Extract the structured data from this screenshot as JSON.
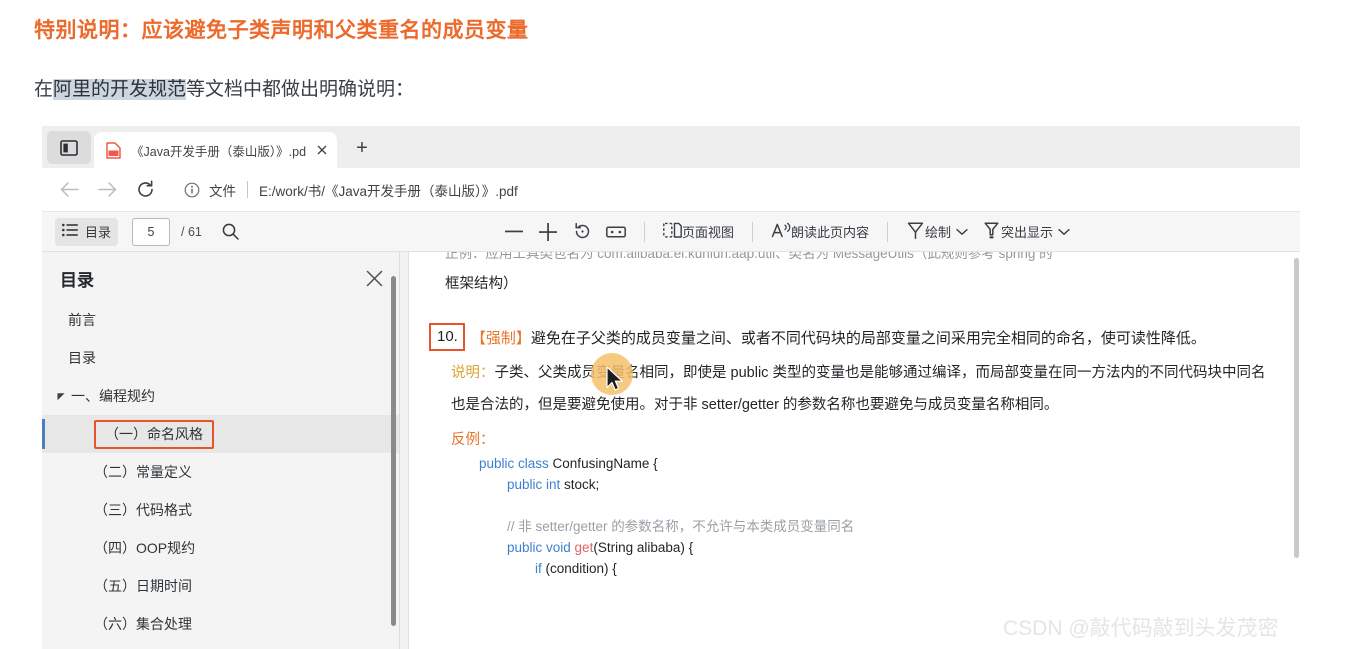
{
  "article": {
    "title": "特别说明：应该避免子类声明和父类重名的成员变量",
    "subtitle_pre": "在",
    "subtitle_selected": "阿里的开发规范",
    "subtitle_post": "等文档中都做出明确说明："
  },
  "colors": {
    "accent_orange": "#ec6a2c",
    "highlight_box": "#e8532c",
    "selection": "#ccd6e0",
    "code_keyword": "#3f7fd0",
    "code_method": "#d9656b",
    "code_comment": "#9aa0a6",
    "note_label": "#d9a437"
  },
  "browser": {
    "sidebar_toggle_icon": "split-panel-icon",
    "tab": {
      "favicon": "pdf-file-icon",
      "title": "《Java开发手册（泰山版）》.pdf",
      "close_icon": "close-icon"
    },
    "new_tab_label": "+",
    "nav": {
      "back_icon": "arrow-left-icon",
      "forward_icon": "arrow-right-icon",
      "reload_icon": "reload-icon"
    },
    "omnibox": {
      "info_icon": "info-circle-icon",
      "scheme_label": "文件",
      "url": "E:/work/书/《Java开发手册（泰山版）》.pdf"
    }
  },
  "pdf_toolbar": {
    "toc_button": {
      "icon": "list-icon",
      "label": "目录"
    },
    "page_current": "5",
    "page_total": "/ 61",
    "find_icon": "search-icon",
    "zoom_out_icon": "minus-icon",
    "zoom_in_icon": "plus-icon",
    "rotate_icon": "rotate-icon",
    "fit_icon": "fit-page-icon",
    "page_view": {
      "icon": "two-page-icon",
      "label": "页面视图"
    },
    "read_aloud": {
      "icon": "read-aloud-icon",
      "label": "朗读此页内容"
    },
    "draw": {
      "icon": "pen-icon",
      "label": "绘制",
      "caret": "chevron-down-icon"
    },
    "highlight": {
      "icon": "highlighter-icon",
      "label": "突出显示",
      "caret": "chevron-down-icon"
    }
  },
  "toc": {
    "title": "目录",
    "close_icon": "close-icon",
    "items": [
      {
        "label": "前言",
        "level": 1,
        "selected": false,
        "caret": false,
        "boxed": false
      },
      {
        "label": "目录",
        "level": 1,
        "selected": false,
        "caret": false,
        "boxed": false
      },
      {
        "label": "一、编程规约",
        "level": 1,
        "selected": false,
        "caret": true,
        "boxed": false
      },
      {
        "label": "（一）命名风格",
        "level": 2,
        "selected": true,
        "caret": false,
        "boxed": true
      },
      {
        "label": "（二）常量定义",
        "level": 2,
        "selected": false,
        "caret": false,
        "boxed": false
      },
      {
        "label": "（三）代码格式",
        "level": 2,
        "selected": false,
        "caret": false,
        "boxed": false
      },
      {
        "label": "（四）OOP规约",
        "level": 2,
        "selected": false,
        "caret": false,
        "boxed": false
      },
      {
        "label": "（五）日期时间",
        "level": 2,
        "selected": false,
        "caret": false,
        "boxed": false
      },
      {
        "label": "（六）集合处理",
        "level": 2,
        "selected": false,
        "caret": false,
        "boxed": false
      }
    ]
  },
  "document": {
    "clipped_top_line": "正例：应用工具类包名为 com.alibaba.ei.kunlun.aap.util、类名为 MessageUtils（此规则参考 spring 的",
    "continuation_line": "框架结构）",
    "rule_number": "10.",
    "rule_tag": "【强制】",
    "rule_text_line1": "避免在子父类的成员变量之间、或者不同代码块的局部变量之间采用完全相同的命名，",
    "rule_text_line2": "使可读性降低。",
    "note_label": "说明：",
    "note_text": "子类、父类成员变量名相同，即使是 public 类型的变量也是能够通过编译，而局部变量在同一方法内的不同代码块中同名也是合法的，但是要避免使用。对于非 setter/getter 的参数名称也要避免与成员变量名称相同。",
    "counter_example_label": "反例：",
    "code_lines": [
      {
        "indent": 0,
        "tokens": [
          {
            "t": "public class ",
            "c": "kw"
          },
          {
            "t": "ConfusingName ",
            "c": "plain"
          },
          {
            "t": "{",
            "c": "plain"
          }
        ]
      },
      {
        "indent": 1,
        "tokens": [
          {
            "t": "public int ",
            "c": "kw"
          },
          {
            "t": "stock;",
            "c": "plain"
          }
        ]
      },
      {
        "indent": 0,
        "tokens": [
          {
            "t": "",
            "c": "plain"
          }
        ]
      },
      {
        "indent": 1,
        "tokens": [
          {
            "t": "// 非 setter/getter 的参数名称，不允许与本类成员变量同名",
            "c": "cmt"
          }
        ]
      },
      {
        "indent": 1,
        "tokens": [
          {
            "t": "public void ",
            "c": "kw"
          },
          {
            "t": "get",
            "c": "mname"
          },
          {
            "t": "(String alibaba) {",
            "c": "plain"
          }
        ]
      },
      {
        "indent": 2,
        "tokens": [
          {
            "t": "if ",
            "c": "kw"
          },
          {
            "t": "(condition) {",
            "c": "plain"
          }
        ]
      }
    ]
  },
  "cursor": {
    "icon": "mouse-pointer-icon",
    "halo_color": "#f5c16a"
  },
  "watermark": "CSDN @敲代码敲到头发茂密"
}
